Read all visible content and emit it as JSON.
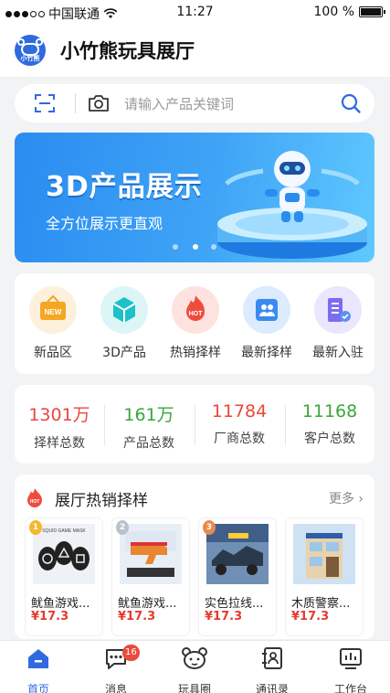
{
  "status_bar": {
    "carrier": "中国联通",
    "time": "11:27",
    "battery": "100 %"
  },
  "header": {
    "logo_text": "小竹熊",
    "title": "小竹熊玩具展厅"
  },
  "search": {
    "placeholder": "请输入产品关键词",
    "icons": [
      "scan-icon",
      "camera-icon",
      "search-icon"
    ]
  },
  "banner": {
    "headline": "3D产品展示",
    "subtitle": "全方位展示更直观",
    "slides": 3,
    "active_slide": 1
  },
  "categories": [
    {
      "label": "新品区",
      "icon": "new-icon",
      "badge": "NEW",
      "color": "#f5a623"
    },
    {
      "label": "3D产品",
      "icon": "cube-icon",
      "color": "#1fc1c9"
    },
    {
      "label": "热销择样",
      "icon": "hot-flame-icon",
      "badge": "HOT",
      "color": "#ef4d3c"
    },
    {
      "label": "最新择样",
      "icon": "people-icon",
      "color": "#3a8bf1"
    },
    {
      "label": "最新入驻",
      "icon": "building-icon",
      "color": "#7b6cf0"
    }
  ],
  "stats": [
    {
      "value": "1301万",
      "label": "择样总数",
      "color": "#e8473c"
    },
    {
      "value": "161万",
      "label": "产品总数",
      "color": "#3aa63a"
    },
    {
      "value": "11784",
      "label": "厂商总数",
      "color": "#e8473c"
    },
    {
      "value": "11168",
      "label": "客户总数",
      "color": "#3aa63a"
    }
  ],
  "hot_section": {
    "title": "展厅热销择样",
    "more": "更多",
    "hot_badge": "HOT",
    "products": [
      {
        "name": "鱿鱼游戏...",
        "price": "¥17.3",
        "rank": "1",
        "rank_color": "#f5b82e",
        "image_text": "SQUID GAME MASK"
      },
      {
        "name": "鱿鱼游戏...",
        "price": "¥17.3",
        "rank": "2",
        "rank_color": "#b9c2cc"
      },
      {
        "name": "实色拉线...",
        "price": "¥17.3",
        "rank": "3",
        "rank_color": "#e98a4a"
      },
      {
        "name": "木质警察...",
        "price": "¥17.3",
        "rank": "",
        "rank_color": ""
      }
    ]
  },
  "tabbar": [
    {
      "label": "首页",
      "icon": "home-icon",
      "active": true
    },
    {
      "label": "消息",
      "icon": "message-icon",
      "badge": "16"
    },
    {
      "label": "玩具圈",
      "icon": "bear-icon"
    },
    {
      "label": "通讯录",
      "icon": "contacts-icon"
    },
    {
      "label": "工作台",
      "icon": "workbench-icon"
    }
  ]
}
